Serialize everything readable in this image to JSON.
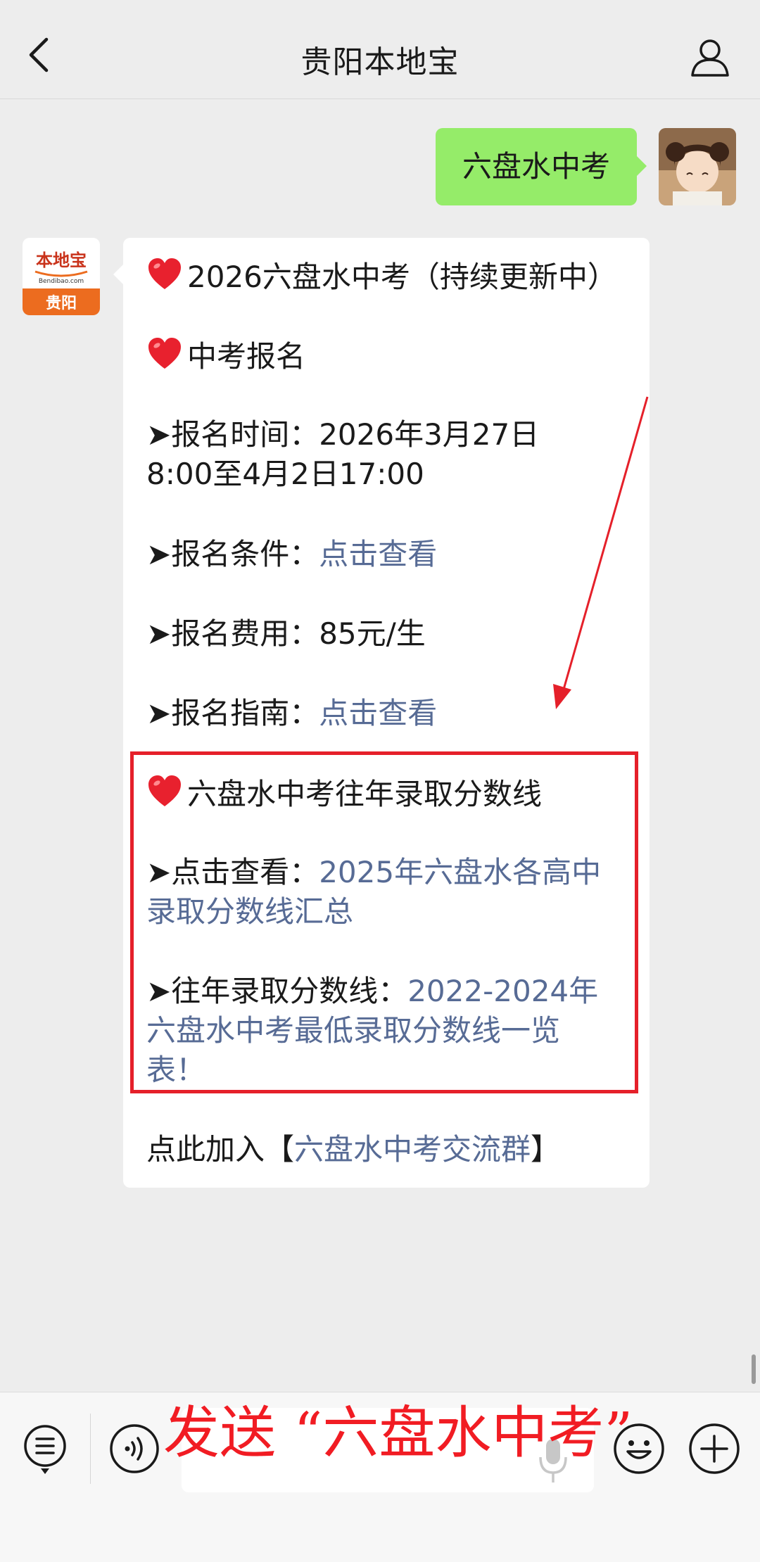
{
  "header": {
    "title": "贵阳本地宝"
  },
  "chat": {
    "my_message": "六盘水中考",
    "bot_avatar": {
      "logo_text": "本地宝",
      "logo_sub": "Bendibao.com",
      "city": "贵阳"
    },
    "bot_message": {
      "heading": "2026六盘水中考（持续更新中）",
      "section1_title": "中考报名",
      "time_label": "➤报名时间：",
      "time_value_1": "2026年3月27日",
      "time_value_2": "8:00至4月2日17:00",
      "cond_label": "➤报名条件：",
      "cond_link": "点击查看",
      "fee_label": "➤报名费用：",
      "fee_value": "85元/生",
      "guide_label": "➤报名指南：",
      "guide_link": "点击查看",
      "section2_title": "六盘水中考往年录取分数线",
      "view_label": "➤点击查看：",
      "view_link_1": "2025年六盘水各高中",
      "view_link_2": "录取分数线汇总",
      "past_label": "➤往年录取分数线：",
      "past_link_1": "2022-2024年",
      "past_link_2": "六盘水中考最低录取分数线一览",
      "past_link_3": "表！",
      "join_prefix": "点此加入【",
      "join_link": "六盘水中考交流群",
      "join_suffix": "】"
    }
  },
  "overlay": {
    "send_instruction": "发送 “六盘水中考”"
  },
  "colors": {
    "accent_red": "#e5202a",
    "link": "#576b95",
    "my_bubble": "#95ec69"
  },
  "icons": [
    "back-arrow-icon",
    "user-icon",
    "heart-icon",
    "menu-list-icon",
    "voice-icon",
    "mic-icon",
    "emoji-icon",
    "plus-icon"
  ]
}
